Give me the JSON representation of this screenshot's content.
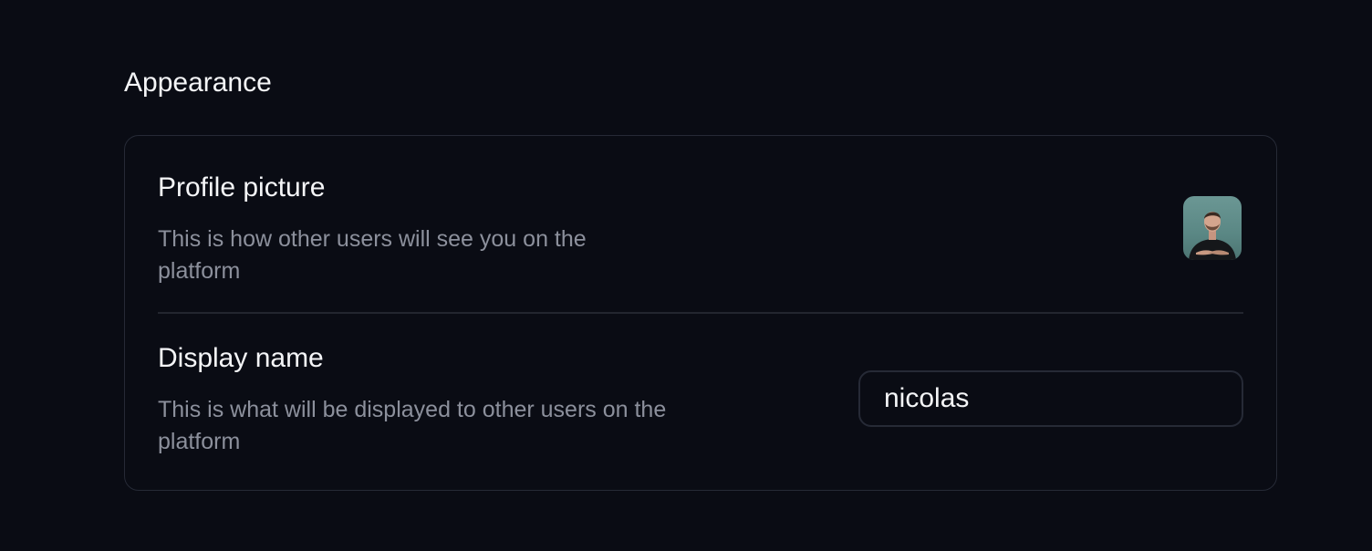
{
  "appearance": {
    "title": "Appearance",
    "profile_picture": {
      "title": "Profile picture",
      "description": "This is how other users will see you on the platform",
      "avatar_icon": "user-photo"
    },
    "display_name": {
      "title": "Display name",
      "description": "This is what will be displayed to other users on the platform",
      "value": "nicolas"
    }
  },
  "colors": {
    "background": "#0a0c14",
    "card_border": "#262a36",
    "text_primary": "#f4f5f7",
    "text_secondary": "#8c909c"
  }
}
